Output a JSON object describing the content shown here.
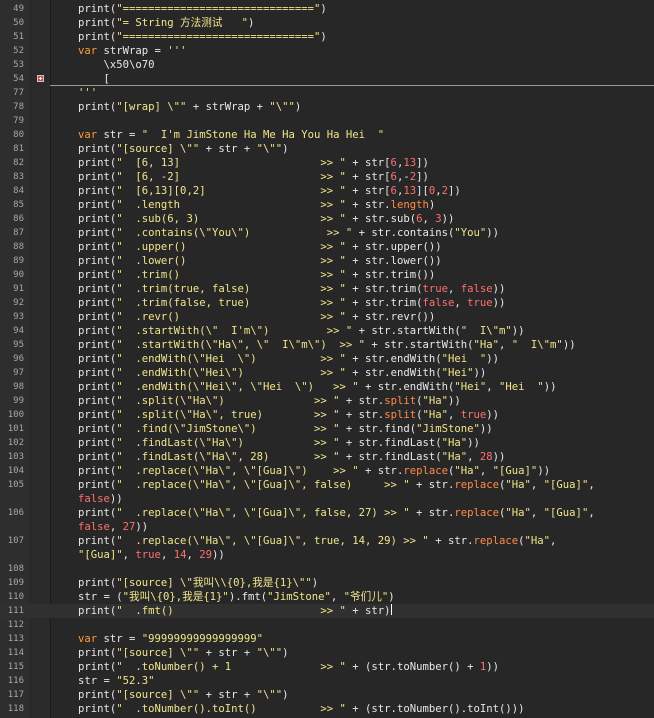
{
  "editor": {
    "fold_marker_line": "54",
    "caret_line": "111",
    "lines": [
      {
        "n": "49",
        "t": "print(\"==============================\")"
      },
      {
        "n": "50",
        "t": "print(\"= String 方法测试   \")"
      },
      {
        "n": "51",
        "t": "print(\"==============================\")"
      },
      {
        "n": "52",
        "t": "var strWrap = '''"
      },
      {
        "n": "53",
        "t": "    \\x50\\o70"
      },
      {
        "n": "54",
        "t": "    ["
      },
      {
        "n": "77",
        "t": "'''"
      },
      {
        "n": "78",
        "t": "print(\"[wrap] \\\"\" + strWrap + \"\\\"\")"
      },
      {
        "n": "79",
        "t": ""
      },
      {
        "n": "80",
        "t": "var str = \"  I'm JimStone Ha Me Ha You Ha Hei  \""
      },
      {
        "n": "81",
        "t": "print(\"[source] \\\"\" + str + \"\\\"\")"
      },
      {
        "n": "82",
        "t": "print(\"  [6, 13]                      >> \" + str[6,13])"
      },
      {
        "n": "83",
        "t": "print(\"  [6, -2]                      >> \" + str[6,-2])"
      },
      {
        "n": "84",
        "t": "print(\"  [6,13][0,2]                  >> \" + str[6,13][0,2])"
      },
      {
        "n": "85",
        "t": "print(\"  .length                      >> \" + str.length)"
      },
      {
        "n": "86",
        "t": "print(\"  .sub(6, 3)                   >> \" + str.sub(6, 3))"
      },
      {
        "n": "87",
        "t": "print(\"  .contains(\\\"You\\\")            >> \" + str.contains(\"You\"))"
      },
      {
        "n": "88",
        "t": "print(\"  .upper()                     >> \" + str.upper())"
      },
      {
        "n": "89",
        "t": "print(\"  .lower()                     >> \" + str.lower())"
      },
      {
        "n": "90",
        "t": "print(\"  .trim()                      >> \" + str.trim())"
      },
      {
        "n": "91",
        "t": "print(\"  .trim(true, false)           >> \" + str.trim(true, false))"
      },
      {
        "n": "92",
        "t": "print(\"  .trim(false, true)           >> \" + str.trim(false, true))"
      },
      {
        "n": "93",
        "t": "print(\"  .revr()                      >> \" + str.revr())"
      },
      {
        "n": "94",
        "t": "print(\"  .startWith(\\\"  I'm\\\")         >> \" + str.startWith(\"  I\\\"m\"))"
      },
      {
        "n": "95",
        "t": "print(\"  .startWith(\\\"Ha\\\", \\\"  I\\\"m\\\")  >> \" + str.startWith(\"Ha\", \"  I\\\"m\"))"
      },
      {
        "n": "96",
        "t": "print(\"  .endWith(\\\"Hei  \\\")          >> \" + str.endWith(\"Hei  \"))"
      },
      {
        "n": "97",
        "t": "print(\"  .endWith(\\\"Hei\\\")            >> \" + str.endWith(\"Hei\"))"
      },
      {
        "n": "98",
        "t": "print(\"  .endWith(\\\"Hei\\\", \\\"Hei  \\\")   >> \" + str.endWith(\"Hei\", \"Hei  \"))"
      },
      {
        "n": "99",
        "t": "print(\"  .split(\\\"Ha\\\")              >> \" + str.split(\"Ha\"))"
      },
      {
        "n": "100",
        "t": "print(\"  .split(\\\"Ha\\\", true)        >> \" + str.split(\"Ha\", true))"
      },
      {
        "n": "101",
        "t": "print(\"  .find(\\\"JimStone\\\")         >> \" + str.find(\"JimStone\"))"
      },
      {
        "n": "102",
        "t": "print(\"  .findLast(\\\"Ha\\\")           >> \" + str.findLast(\"Ha\"))"
      },
      {
        "n": "103",
        "t": "print(\"  .findLast(\\\"Ha\\\", 28)       >> \" + str.findLast(\"Ha\", 28))"
      },
      {
        "n": "104",
        "t": "print(\"  .replace(\\\"Ha\\\", \\\"[Gua]\\\")    >> \" + str.replace(\"Ha\", \"[Gua]\"))"
      },
      {
        "n": "105",
        "t": "print(\"  .replace(\\\"Ha\\\", \\\"[Gua]\\\", false)     >> \" + str.replace(\"Ha\", \"[Gua]\","
      },
      {
        "n": "",
        "t": "false))"
      },
      {
        "n": "106",
        "t": "print(\"  .replace(\\\"Ha\\\", \\\"[Gua]\\\", false, 27) >> \" + str.replace(\"Ha\", \"[Gua]\","
      },
      {
        "n": "",
        "t": "false, 27))"
      },
      {
        "n": "107",
        "t": "print(\"  .replace(\\\"Ha\\\", \\\"[Gua]\\\", true, 14, 29) >> \" + str.replace(\"Ha\","
      },
      {
        "n": "",
        "t": "\"[Gua]\", true, 14, 29))"
      },
      {
        "n": "108",
        "t": ""
      },
      {
        "n": "109",
        "t": "print(\"[source] \\\"我叫\\\\{0},我是{1}\\\"\")"
      },
      {
        "n": "110",
        "t": "str = (\"我叫\\{0},我是{1}\").fmt(\"JimStone\", \"爷们儿\")"
      },
      {
        "n": "111",
        "t": "print(\"  .fmt()                       >> \" + str)"
      },
      {
        "n": "112",
        "t": ""
      },
      {
        "n": "113",
        "t": "var str = \"99999999999999999\""
      },
      {
        "n": "114",
        "t": "print(\"[source] \\\"\" + str + \"\\\"\")"
      },
      {
        "n": "115",
        "t": "print(\"  .toNumber() + 1              >> \" + (str.toNumber() + 1))"
      },
      {
        "n": "116",
        "t": "str = \"52.3\""
      },
      {
        "n": "117",
        "t": "print(\"[source] \\\"\" + str + \"\\\"\")"
      },
      {
        "n": "118",
        "t": "print(\"  .toNumber().toInt()          >> \" + (str.toNumber().toInt()))"
      }
    ]
  },
  "colors": {
    "background": "#272727",
    "keyword": "#ff9d3a",
    "string": "#f2e58c",
    "number": "#ff7070",
    "method": "#ff8c4a",
    "text": "#e8e8e8",
    "line_number": "#a8a8a8"
  },
  "icons": {
    "fold_marker": "fold-expand-icon"
  }
}
